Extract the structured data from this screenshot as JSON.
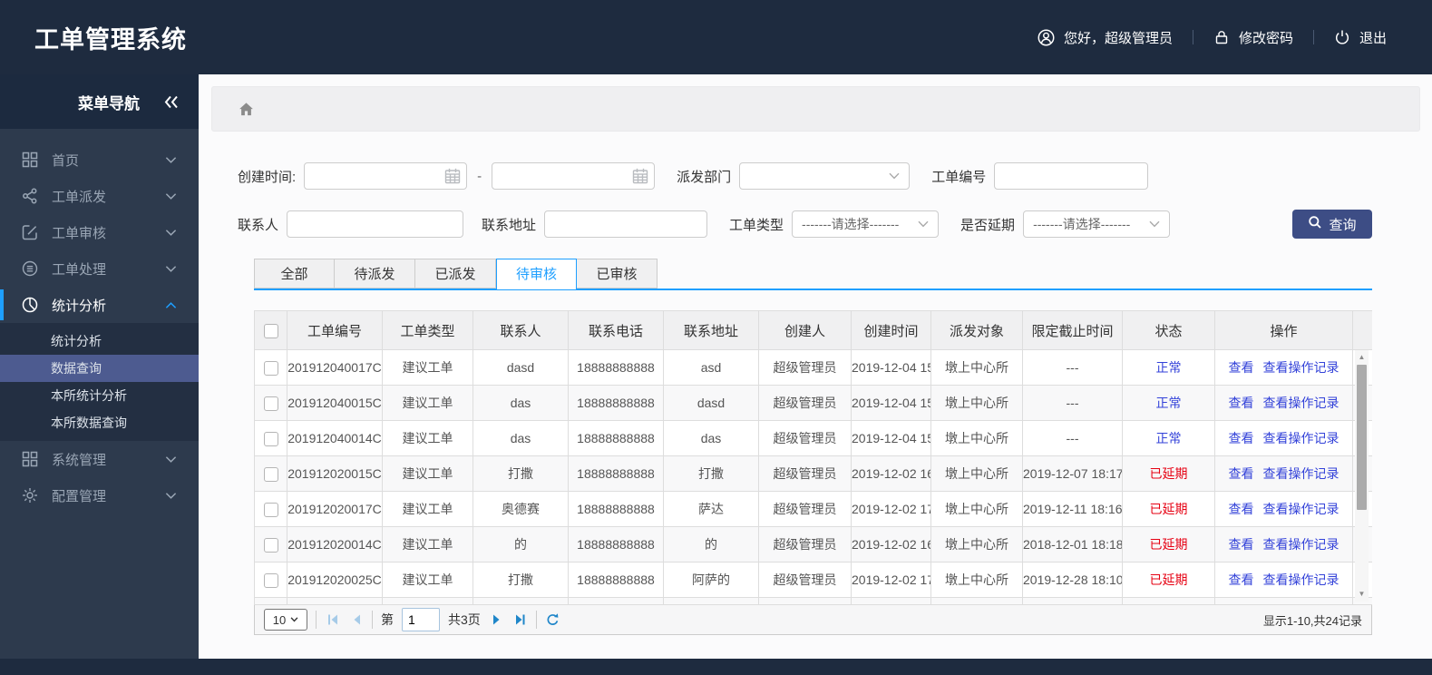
{
  "header": {
    "title": "工单管理系统",
    "greeting": "您好，超级管理员",
    "change_password": "修改密码",
    "logout": "退出"
  },
  "sidebar": {
    "nav_title": "菜单导航",
    "items": [
      {
        "name": "home",
        "icon": "grid",
        "label": "首页",
        "chevron": "down"
      },
      {
        "name": "dispatch",
        "icon": "share",
        "label": "工单派发",
        "chevron": "down"
      },
      {
        "name": "review",
        "icon": "edit",
        "label": "工单审核",
        "chevron": "down"
      },
      {
        "name": "process",
        "icon": "process",
        "label": "工单处理",
        "chevron": "down"
      },
      {
        "name": "stats",
        "icon": "pie",
        "label": "统计分析",
        "chevron": "up",
        "active": true,
        "children": [
          {
            "label": "统计分析"
          },
          {
            "label": "数据查询",
            "active": true
          },
          {
            "label": "本所统计分析"
          },
          {
            "label": "本所数据查询"
          }
        ]
      },
      {
        "name": "system",
        "icon": "grid",
        "label": "系统管理",
        "chevron": "down"
      },
      {
        "name": "config",
        "icon": "gear",
        "label": "配置管理",
        "chevron": "down"
      }
    ]
  },
  "filters": {
    "create_time_label": "创建时间:",
    "separator": "-",
    "dispatch_dept_label": "派发部门",
    "order_no_label": "工单编号",
    "contact_label": "联系人",
    "address_label": "联系地址",
    "order_type_label": "工单类型",
    "order_type_placeholder": "-------请选择-------",
    "delay_label": "是否延期",
    "delay_placeholder": "-------请选择-------",
    "search_button": "查询"
  },
  "tabs": [
    "全部",
    "待派发",
    "已派发",
    "待审核",
    "已审核"
  ],
  "active_tab": 3,
  "table": {
    "headers": [
      "工单编号",
      "工单类型",
      "联系人",
      "联系电话",
      "联系地址",
      "创建人",
      "创建时间",
      "派发对象",
      "限定截止时间",
      "状态",
      "操作"
    ],
    "action_labels": [
      "查看",
      "查看操作记录"
    ],
    "rows": [
      {
        "order_no": "201912040017C",
        "type": "建议工单",
        "contact": "dasd",
        "phone": "18888888888",
        "address": "asd",
        "creator": "超级管理员",
        "created": "2019-12-04 15",
        "target": "墩上中心所",
        "deadline": "---",
        "status": "正常",
        "status_type": "normal"
      },
      {
        "order_no": "201912040015C",
        "type": "建议工单",
        "contact": "das",
        "phone": "18888888888",
        "address": "dasd",
        "creator": "超级管理员",
        "created": "2019-12-04 15",
        "target": "墩上中心所",
        "deadline": "---",
        "status": "正常",
        "status_type": "normal"
      },
      {
        "order_no": "201912040014C",
        "type": "建议工单",
        "contact": "das",
        "phone": "18888888888",
        "address": "das",
        "creator": "超级管理员",
        "created": "2019-12-04 15",
        "target": "墩上中心所",
        "deadline": "---",
        "status": "正常",
        "status_type": "normal"
      },
      {
        "order_no": "201912020015C",
        "type": "建议工单",
        "contact": "打撒",
        "phone": "18888888888",
        "address": "打撒",
        "creator": "超级管理员",
        "created": "2019-12-02 16",
        "target": "墩上中心所",
        "deadline": "2019-12-07 18:17",
        "status": "已延期",
        "status_type": "delayed"
      },
      {
        "order_no": "201912020017C",
        "type": "建议工单",
        "contact": "奥德赛",
        "phone": "18888888888",
        "address": "萨达",
        "creator": "超级管理员",
        "created": "2019-12-02 17",
        "target": "墩上中心所",
        "deadline": "2019-12-11 18:16",
        "status": "已延期",
        "status_type": "delayed"
      },
      {
        "order_no": "201912020014C",
        "type": "建议工单",
        "contact": "的",
        "phone": "18888888888",
        "address": "的",
        "creator": "超级管理员",
        "created": "2019-12-02 16",
        "target": "墩上中心所",
        "deadline": "2018-12-01 18:18",
        "status": "已延期",
        "status_type": "delayed"
      },
      {
        "order_no": "201912020025C",
        "type": "建议工单",
        "contact": "打撒",
        "phone": "18888888888",
        "address": "阿萨的",
        "creator": "超级管理员",
        "created": "2019-12-02 17",
        "target": "墩上中心所",
        "deadline": "2019-12-28 18:10",
        "status": "已延期",
        "status_type": "delayed"
      }
    ]
  },
  "pagination": {
    "page_size": "10",
    "page_prefix": "第",
    "page_value": "1",
    "total_pages": "共3页",
    "summary": "显示1-10,共24记录"
  },
  "colors": {
    "accent": "#1e9fff",
    "header_bg": "#1e2b3f",
    "sidebar_bg": "#2d3a4d",
    "submenu_active_bg": "#4d5b90",
    "search_button_bg": "#3d4d85",
    "link_blue": "#3342d9",
    "status_normal": "#3342d9",
    "status_delayed": "#e60012"
  }
}
